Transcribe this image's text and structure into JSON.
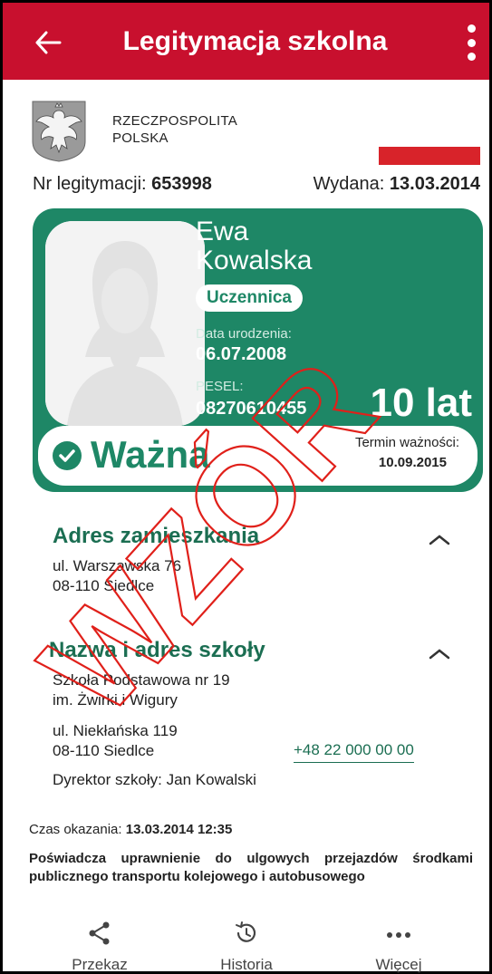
{
  "appbar": {
    "title": "Legitymacja szkolna",
    "back_icon": "arrow-left-icon",
    "menu_icon": "more-vertical-icon",
    "color": "#c8102e"
  },
  "header": {
    "country_line1": "RZECZPOSPOLITA",
    "country_line2": "POLSKA",
    "id_label": "Nr legitymacji:",
    "id_value": "653998",
    "issued_label": "Wydana:",
    "issued_value": "13.03.2014"
  },
  "card": {
    "color": "#1e8766",
    "first_name": "Ewa",
    "last_name": "Kowalska",
    "role": "Uczennica",
    "dob_label": "Data urodzenia:",
    "dob_value": "06.07.2008",
    "pesel_label": "PESEL:",
    "pesel_value": "08270610455",
    "age": "10 lat",
    "status": "Ważna",
    "valid_until_label": "Termin ważności:",
    "valid_until_value": "10.09.2015"
  },
  "address": {
    "title": "Adres zamieszkania",
    "line1": "ul. Warszawska 76",
    "line2": "08-110 Siedlce"
  },
  "school": {
    "title": "Nazwa i adres szkoły",
    "name_line1": "Szkoła Podstawowa nr 19",
    "name_line2": "im. Żwirki i Wigury",
    "street": "ul. Niekłańska 119",
    "city": "08-110 Siedlce",
    "phone": "+48 22 000 00 00",
    "director_label": "Dyrektor szkoły:",
    "director_name": "Jan Kowalski"
  },
  "footer": {
    "shown_label": "Czas okazania:",
    "shown_value": "13.03.2014 12:35",
    "note": "Poświadcza uprawnienie do ulgowych przejazdów środkami publicznego transportu kolejowego i autobusowego"
  },
  "nav": [
    {
      "label": "Przekaz",
      "icon": "share-icon"
    },
    {
      "label": "Historia",
      "icon": "history-icon"
    },
    {
      "label": "Więcej",
      "icon": "more-horizontal-icon"
    }
  ],
  "watermark": {
    "text": "WZÓR",
    "color": "#e0201a"
  }
}
